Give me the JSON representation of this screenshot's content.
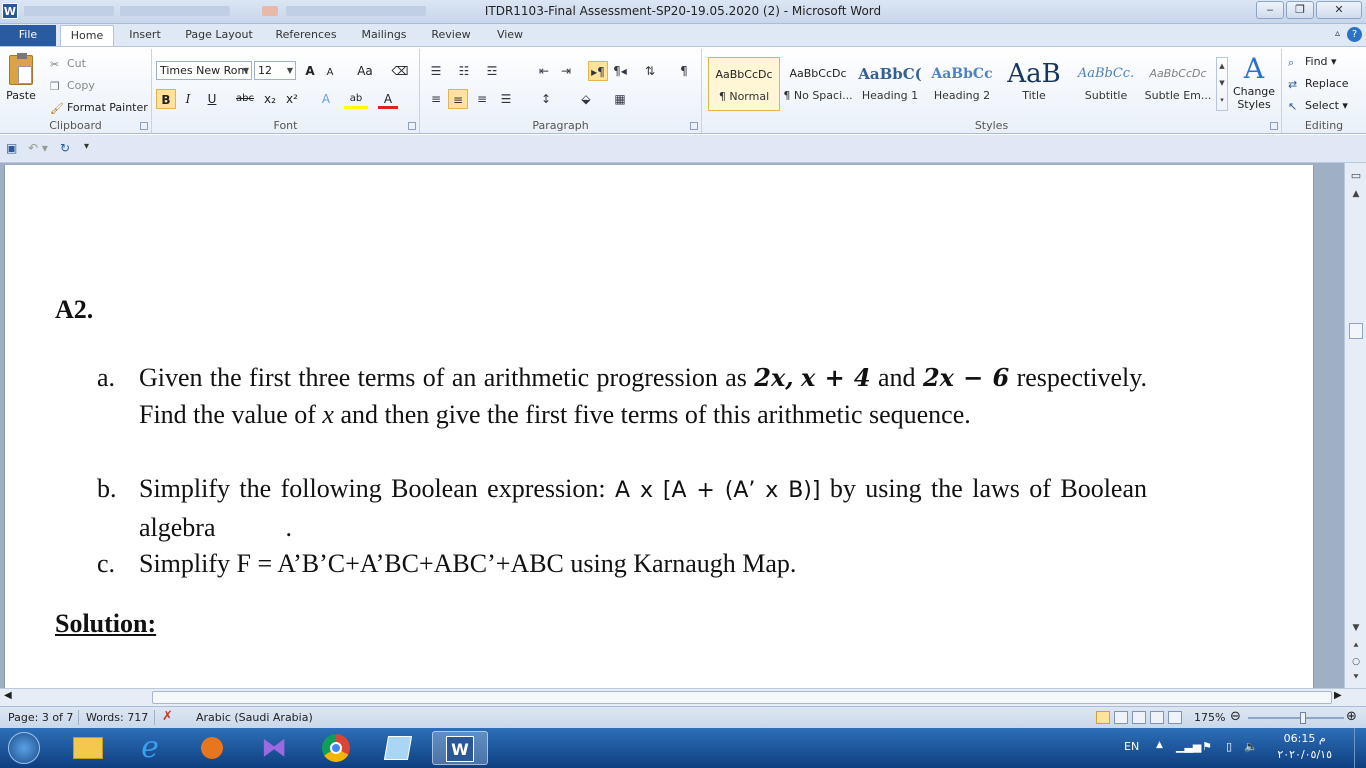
{
  "window": {
    "title": "ITDR1103-Final Assessment-SP20-19.05.2020 (2)  -  Microsoft Word",
    "app_letter": "W",
    "minimize": "‒",
    "restore": "❐",
    "close": "✕"
  },
  "tabs": [
    {
      "label": "File"
    },
    {
      "label": "Home"
    },
    {
      "label": "Insert"
    },
    {
      "label": "Page Layout"
    },
    {
      "label": "References"
    },
    {
      "label": "Mailings"
    },
    {
      "label": "Review"
    },
    {
      "label": "View"
    }
  ],
  "help": "?",
  "ribbon": {
    "clipboard": {
      "label": "Clipboard",
      "paste": "Paste",
      "cut": "Cut",
      "copy": "Copy",
      "format_painter": "Format Painter"
    },
    "font": {
      "label": "Font",
      "font_name": "Times New Rom",
      "font_size": "12",
      "grow": "A",
      "shrink": "A",
      "change_case": "Aa",
      "bold": "B",
      "italic": "I",
      "underline": "U",
      "strike": "abc",
      "subscript": "x₂",
      "superscript": "x²",
      "highlight": "ab",
      "font_color": "A"
    },
    "paragraph": {
      "label": "Paragraph",
      "pilcrow": "¶"
    },
    "styles": {
      "label": "Styles",
      "items": [
        {
          "sample": "AaBbCcDc",
          "name": "¶ Normal"
        },
        {
          "sample": "AaBbCcDc",
          "name": "¶ No Spaci..."
        },
        {
          "sample": "AaBbC(",
          "name": "Heading 1"
        },
        {
          "sample": "AaBbCc",
          "name": "Heading 2"
        },
        {
          "sample": "AaB",
          "name": "Title"
        },
        {
          "sample": "AaBbCc.",
          "name": "Subtitle"
        },
        {
          "sample": "AaBbCcDc",
          "name": "Subtle Em..."
        }
      ],
      "change_styles": "Change Styles"
    },
    "editing": {
      "label": "Editing",
      "find": "Find",
      "replace": "Replace",
      "select": "Select"
    }
  },
  "document": {
    "heading": "A2.",
    "items": [
      {
        "label": "a.",
        "t1": "Given the first three terms of an arithmetic progression as ",
        "m1": "2x,",
        "m2": "x + 4",
        "t2": " and ",
        "m3": "2x − 6",
        "t3": " respectively. Find the value of ",
        "m4": "x",
        "t4": " and then give the first five terms of this arithmetic sequence."
      },
      {
        "label": "b.",
        "t1": "Simplify the following Boolean expression:  ",
        "expr": "A x [A + (A’ x B)]",
        "t2": " by using the laws of Boolean algebra",
        "t3": "."
      },
      {
        "label": "c.",
        "t1": "Simplify F = A’B’C+A’BC+ABC’+ABC using Karnaugh Map."
      }
    ],
    "solution": "Solution:"
  },
  "statusbar": {
    "page": "Page: 3 of 7",
    "words": "Words: 717",
    "language": "Arabic (Saudi Arabia)",
    "zoom": "175%"
  },
  "taskbar": {
    "lang": "EN",
    "time": "06:15 م",
    "date": "٢٠٢٠/٠٥/١٥"
  },
  "colors": {
    "file_tab": "#2a5aa0",
    "taskbar": "#1b56a0",
    "selection_highlight": "#ffe39a"
  }
}
